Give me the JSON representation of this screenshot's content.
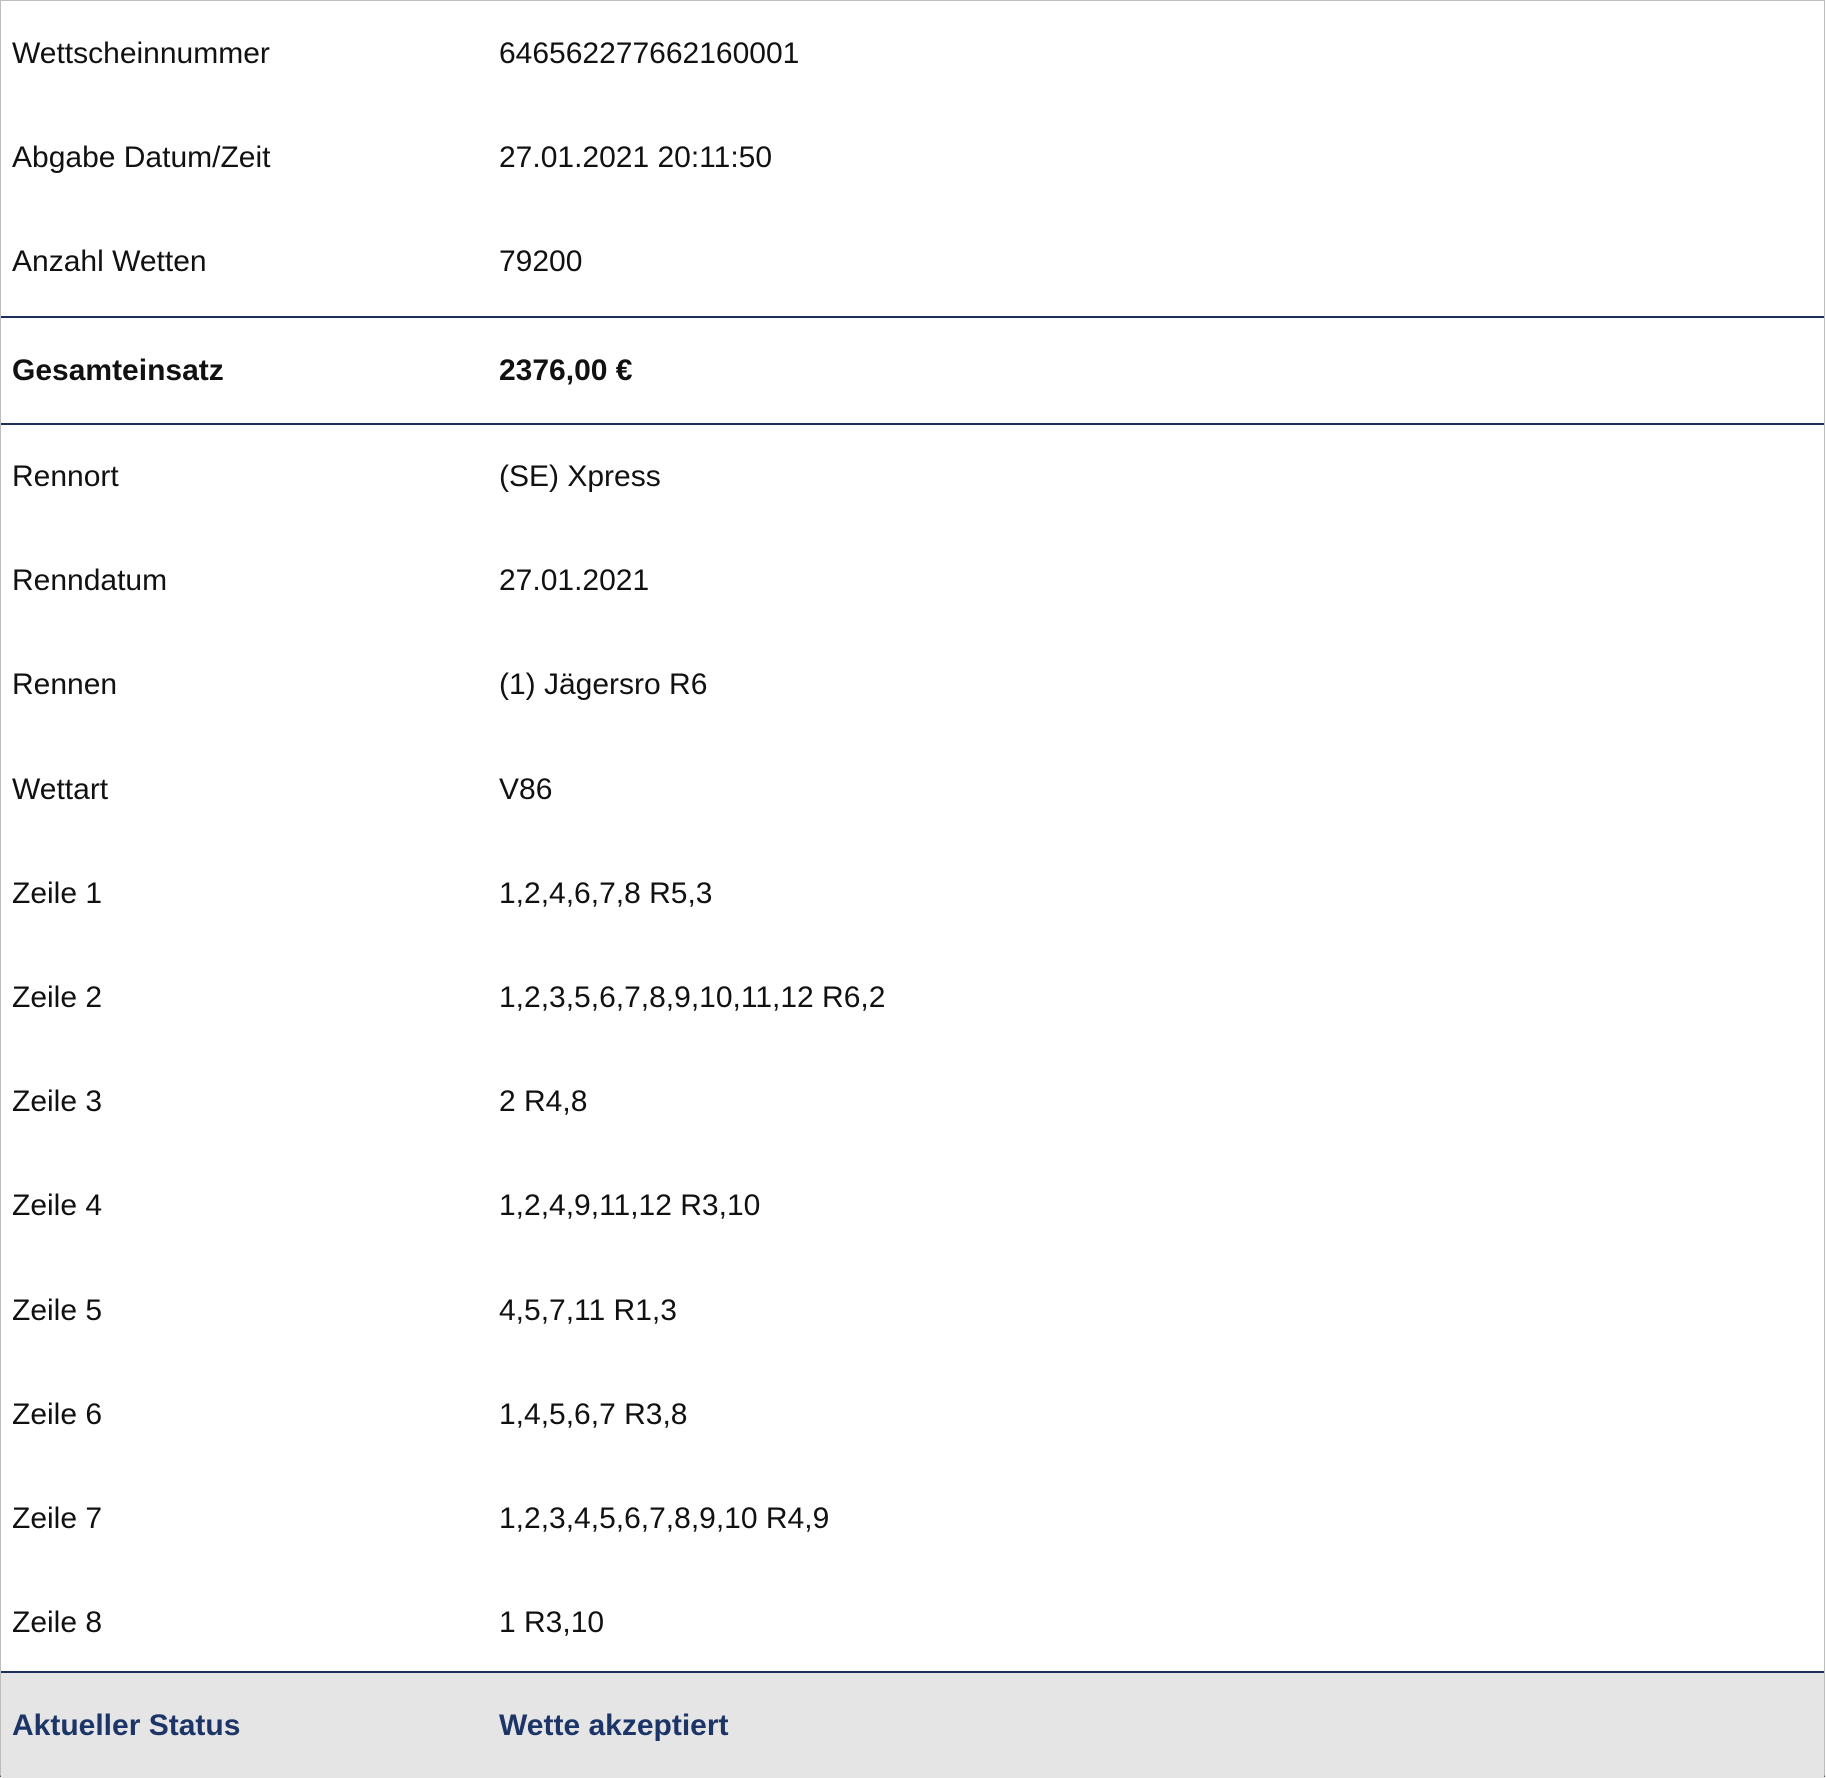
{
  "ticket": {
    "header_rows": [
      {
        "label": "Wettscheinnummer",
        "value": "646562277662160001"
      },
      {
        "label": "Abgabe Datum/Zeit",
        "value": "27.01.2021 20:11:50"
      },
      {
        "label": "Anzahl Wetten",
        "value": "79200"
      }
    ],
    "total": {
      "label": "Gesamteinsatz",
      "value": "2376,00 €"
    },
    "detail_rows": [
      {
        "label": "Rennort",
        "value": "(SE) Xpress"
      },
      {
        "label": "Renndatum",
        "value": "27.01.2021"
      },
      {
        "label": "Rennen",
        "value": "(1) Jägersro R6"
      },
      {
        "label": "Wettart",
        "value": "V86"
      },
      {
        "label": "Zeile 1",
        "value": "1,2,4,6,7,8 R5,3"
      },
      {
        "label": "Zeile 2",
        "value": "1,2,3,5,6,7,8,9,10,11,12 R6,2"
      },
      {
        "label": "Zeile 3",
        "value": "2 R4,8"
      },
      {
        "label": "Zeile 4",
        "value": "1,2,4,9,11,12 R3,10"
      },
      {
        "label": "Zeile 5",
        "value": "4,5,7,11 R1,3"
      },
      {
        "label": "Zeile 6",
        "value": "1,4,5,6,7 R3,8"
      },
      {
        "label": "Zeile 7",
        "value": "1,2,3,4,5,6,7,8,9,10 R4,9"
      },
      {
        "label": "Zeile 8",
        "value": "1 R3,10"
      }
    ],
    "status": {
      "label": "Aktueller Status",
      "value": "Wette akzeptiert"
    }
  },
  "colors": {
    "accent": "#1c3566",
    "status_background": "#e5e5e6",
    "divider": "#1c2f5c"
  }
}
